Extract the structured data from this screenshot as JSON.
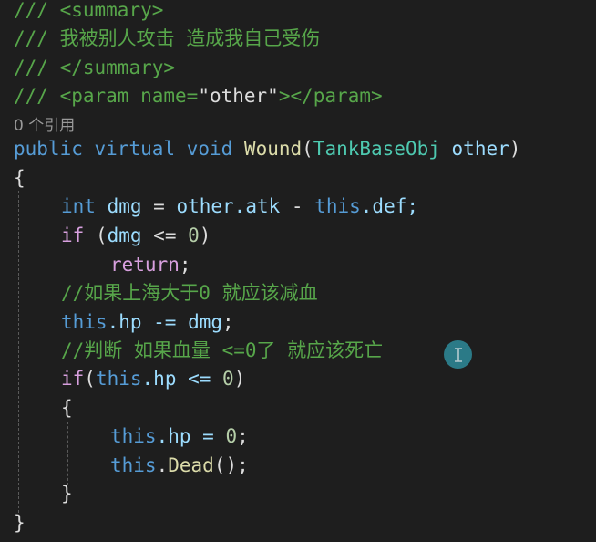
{
  "code": {
    "line1": {
      "slashes": "///",
      "text": " <summary>"
    },
    "line2": {
      "slashes": "///",
      "text": " 我被别人攻击 造成我自己受伤"
    },
    "line3": {
      "slashes": "///",
      "text": " </summary>"
    },
    "line4": {
      "slashes": "///",
      "open": " <param ",
      "attr": "name",
      "eq": "=",
      "value": "\"other\"",
      "close": "></param>"
    },
    "codelens": "0 个引用",
    "line6": {
      "kw_public": "public",
      "kw_virtual": "virtual",
      "kw_void": "void",
      "method": "Wound",
      "open_paren": "(",
      "param_type": "TankBaseObj",
      "param_name": "other",
      "close_paren": ")"
    },
    "line7": {
      "brace": "{"
    },
    "line8": {
      "kw_int": "int",
      "var": "dmg",
      "assign": " = ",
      "expr_other": "other.atk",
      "minus": " - ",
      "kw_this": "this",
      "member": ".def;"
    },
    "line9": {
      "kw_if": "if",
      "cond_open": " (",
      "var": "dmg",
      "cond": " <= ",
      "num": "0",
      "cond_close": ")"
    },
    "line10": {
      "kw_return": "return",
      "semi": ";"
    },
    "line11": {
      "comment": "//如果上海大于0 就应该减血"
    },
    "line12": {
      "kw_this": "this",
      "member": ".hp -= ",
      "var": "dmg",
      "semi": ";"
    },
    "line13": {
      "comment": "//判断 如果血量 <=0了 就应该死亡"
    },
    "line14": {
      "kw_if": "if",
      "open": "(",
      "kw_this": "this",
      "member": ".hp <= ",
      "num": "0",
      "close": ")"
    },
    "line15": {
      "brace": "{"
    },
    "line16": {
      "kw_this": "this",
      "member": ".hp = ",
      "num": "0",
      "semi": ";"
    },
    "line17": {
      "kw_this": "this",
      "member": ".",
      "method": "Dead",
      "call": "();"
    },
    "line18": {
      "brace": "}"
    },
    "line19": {
      "brace": "}"
    }
  },
  "icons": {
    "cursor": "text-cursor-icon"
  },
  "colors": {
    "background": "#1e1e1e",
    "comment": "#57a64a",
    "keyword": "#569cd6",
    "control": "#d8a0df",
    "type": "#4ec9b0",
    "string": "#d69d85",
    "number": "#b5cea8",
    "variable": "#9cdcfe",
    "method": "#dcdcaa",
    "cursor_badge": "#2e8b9a"
  }
}
